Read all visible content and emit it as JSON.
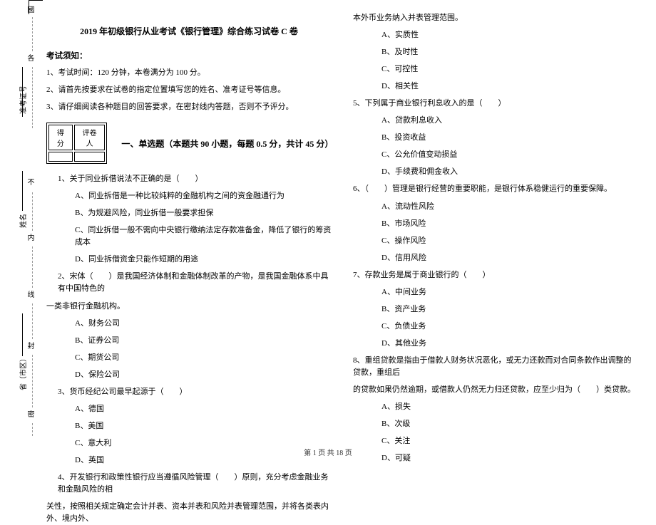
{
  "sideband": {
    "guo": "國",
    "ge": "各",
    "zhunkao": "准考证号",
    "bu": "不",
    "xingming": "姓名",
    "nei": "内",
    "xian": "线",
    "feng": "封",
    "sheng": "省（市区）",
    "mi": "密"
  },
  "header": {
    "title": "2019 年初级银行从业考试《银行管理》综合练习试卷 C 卷"
  },
  "instructions": {
    "heading": "考试须知：",
    "i1": "1、考试时间：120 分钟，本卷满分为 100 分。",
    "i2": "2、请首先按要求在试卷的指定位置填写您的姓名、准考证号等信息。",
    "i3": "3、请仔细阅读各种题目的回答要求，在密封线内答题，否则不予评分。"
  },
  "scorebox": {
    "h1": "得分",
    "h2": "评卷人"
  },
  "section1": {
    "title": "一、单选题（本题共 90 小题，每题 0.5 分，共计 45 分）"
  },
  "q1": {
    "stem": "1、关于同业拆借说法不正确的是（　　）",
    "a": "A、同业拆借是一种比较纯粹的金融机构之间的资金融通行为",
    "b": "B、为规避风险，同业拆借一般要求担保",
    "c": "C、同业拆借一般不需向中央银行缴纳法定存款准备金，降低了银行的筹资成本",
    "d": "D、同业拆借资金只能作短期的用途"
  },
  "q2": {
    "stem_a": "2、宋体（　　）是我国经济体制和金融体制改革的产物，是我国金融体系中具有中国特色的",
    "stem_b": "一类非银行金融机构。",
    "a": "A、财务公司",
    "b": "B、证券公司",
    "c": "C、期货公司",
    "d": "D、保险公司"
  },
  "q3": {
    "stem": "3、货币经纪公司最早起源于（　　）",
    "a": "A、德国",
    "b": "B、美国",
    "c": "C、意大利",
    "d": "D、英国"
  },
  "q4": {
    "stem_a": "4、开发银行和政策性银行应当遵循风险管理（　　）原则，充分考虑金融业务和金融风险的相",
    "stem_b": "关性，按照相关规定确定会计并表、资本并表和风险并表管理范围，并将各类表内外、境内外、"
  },
  "q4cont": {
    "line": "本外币业务纳入并表管理范围。",
    "a": "A、实质性",
    "b": "B、及时性",
    "c": "C、可控性",
    "d": "D、相关性"
  },
  "q5": {
    "stem": "5、下列属于商业银行利息收入的是（　　）",
    "a": "A、贷款利息收入",
    "b": "B、投资收益",
    "c": "C、公允价值变动损益",
    "d": "D、手续费和佣金收入"
  },
  "q6": {
    "stem": "6、（　　）管理是银行经营的重要职能，是银行体系稳健运行的重要保障。",
    "a": "A、流动性风险",
    "b": "B、市场风险",
    "c": "C、操作风险",
    "d": "D、信用风险"
  },
  "q7": {
    "stem": "7、存款业务是属于商业银行的（　　）",
    "a": "A、中间业务",
    "b": "B、资产业务",
    "c": "C、负债业务",
    "d": "D、其他业务"
  },
  "q8": {
    "stem_a": "8、重组贷款是指由于借款人财务状况恶化，或无力还款而对合同条款作出调整的贷款，重组后",
    "stem_b": "的贷款如果仍然逾期，或借款人仍然无力归还贷款，应至少归为（　　）类贷款。",
    "a": "A、损失",
    "b": "B、次级",
    "c": "C、关注",
    "d": "D、可疑"
  },
  "footer": {
    "pagenum": "第 1 页 共 18 页"
  }
}
